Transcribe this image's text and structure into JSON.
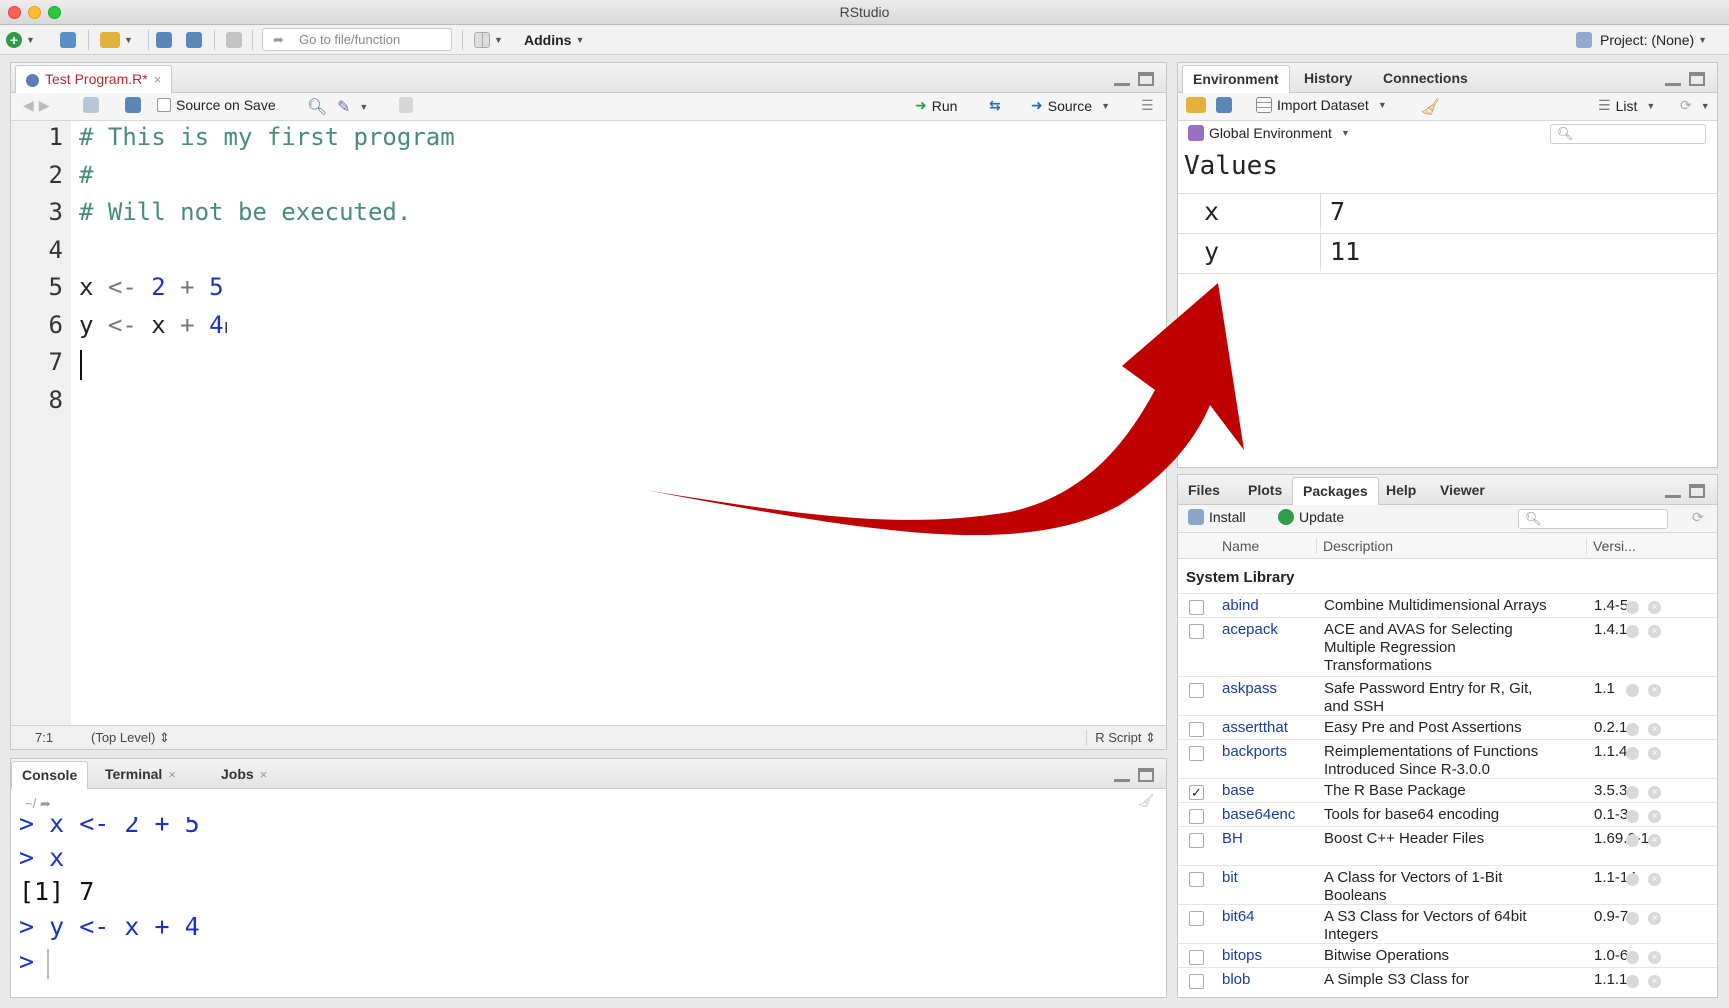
{
  "window": {
    "title": "RStudio"
  },
  "toolbar": {
    "goto_placeholder": "Go to file/function",
    "addins_label": "Addins",
    "project_label": "Project: (None)"
  },
  "editor": {
    "tab_label": "Test Program.R*",
    "source_on_save": "Source on Save",
    "run_label": "Run",
    "source_label": "Source",
    "line_numbers": [
      "1",
      "2",
      "3",
      "4",
      "5",
      "6",
      "7",
      "8"
    ],
    "lines": [
      "# This is my first program",
      "#",
      "# Will not be executed.",
      "",
      "x <- 2 + 5",
      "y <- x + 4",
      "",
      ""
    ],
    "status": {
      "position": "7:1",
      "scope": "(Top Level)",
      "file_type": "R Script"
    }
  },
  "console": {
    "tabs": [
      "Console",
      "Terminal",
      "Jobs"
    ],
    "working_dir": "~/",
    "lines": [
      {
        "kind": "prompt",
        "text": "> x <- 2 + 5"
      },
      {
        "kind": "prompt",
        "text": "> x"
      },
      {
        "kind": "output",
        "text": "[1] 7"
      },
      {
        "kind": "prompt",
        "text": "> y <- x + 4"
      },
      {
        "kind": "prompt",
        "text": "> "
      }
    ]
  },
  "environment": {
    "tabs": [
      "Environment",
      "History",
      "Connections"
    ],
    "import_label": "Import Dataset",
    "view_mode": "List",
    "scope": "Global Environment",
    "values_title": "Values",
    "values": [
      {
        "name": "x",
        "value": "7"
      },
      {
        "name": "y",
        "value": "11"
      }
    ]
  },
  "files_pane": {
    "tabs": [
      "Files",
      "Plots",
      "Packages",
      "Help",
      "Viewer"
    ],
    "active_tab": "Packages",
    "install_label": "Install",
    "update_label": "Update",
    "columns": [
      "Name",
      "Description",
      "Versi..."
    ],
    "section": "System Library",
    "packages": [
      {
        "name": "abind",
        "desc": "Combine Multidimensional Arrays",
        "version": "1.4-5",
        "checked": false
      },
      {
        "name": "acepack",
        "desc": "ACE and AVAS for Selecting Multiple Regression Transformations",
        "version": "1.4.1",
        "checked": false
      },
      {
        "name": "askpass",
        "desc": "Safe Password Entry for R, Git, and SSH",
        "version": "1.1",
        "checked": false
      },
      {
        "name": "assertthat",
        "desc": "Easy Pre and Post Assertions",
        "version": "0.2.1",
        "checked": false
      },
      {
        "name": "backports",
        "desc": "Reimplementations of Functions Introduced Since R-3.0.0",
        "version": "1.1.4",
        "checked": false
      },
      {
        "name": "base",
        "desc": "The R Base Package",
        "version": "3.5.3",
        "checked": true
      },
      {
        "name": "base64enc",
        "desc": "Tools for base64 encoding",
        "version": "0.1-3",
        "checked": false
      },
      {
        "name": "BH",
        "desc": "Boost C++ Header Files",
        "version": "1.69.0-1",
        "checked": false
      },
      {
        "name": "bit",
        "desc": "A Class for Vectors of 1-Bit Booleans",
        "version": "1.1-14",
        "checked": false
      },
      {
        "name": "bit64",
        "desc": "A S3 Class for Vectors of 64bit Integers",
        "version": "0.9-7",
        "checked": false
      },
      {
        "name": "bitops",
        "desc": "Bitwise Operations",
        "version": "1.0-6",
        "checked": false
      },
      {
        "name": "blob",
        "desc": "A Simple S3 Class for",
        "version": "1.1.1",
        "checked": false
      }
    ]
  },
  "annotation": {
    "arrow_color": "#c00000"
  }
}
